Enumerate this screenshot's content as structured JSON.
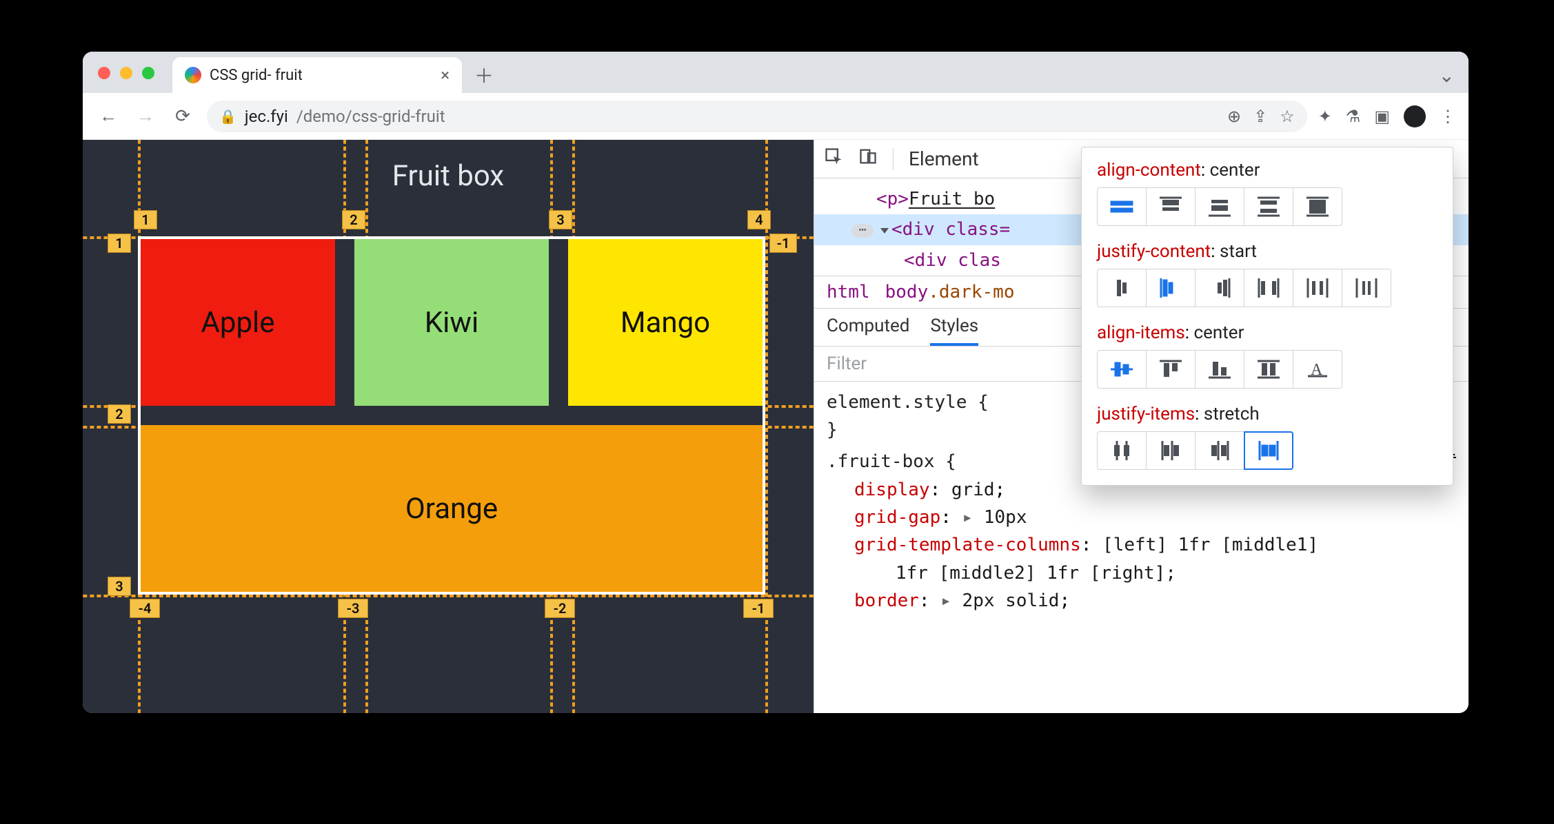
{
  "tab": {
    "title": "CSS grid- fruit"
  },
  "address": {
    "host": "jec.fyi",
    "path": "/demo/css-grid-fruit"
  },
  "page": {
    "heading": "Fruit box",
    "cells": {
      "apple": "Apple",
      "kiwi": "Kiwi",
      "mango": "Mango",
      "orange": "Orange"
    },
    "grid_numbers_top": [
      "1",
      "2",
      "3",
      "4"
    ],
    "grid_numbers_left": [
      "1",
      "2",
      "3"
    ],
    "grid_numbers_right_top": "-1",
    "grid_numbers_bottom": [
      "-4",
      "-3",
      "-2",
      "-1"
    ]
  },
  "devtools": {
    "panel": "Element",
    "dom": {
      "line1_open": "<p>",
      "line1_text": "Fruit bo",
      "line2": "<div class=",
      "line3": "<div clas"
    },
    "crumbs": {
      "a": "html",
      "b": "body",
      "bcls": ".dark-mo"
    },
    "tabs": {
      "computed": "Computed",
      "styles": "Styles"
    },
    "filter_placeholder": "Filter",
    "styles": {
      "inline_open": "element.style {",
      "inline_close": "}",
      "rule_selector": ".fruit-box {",
      "display": {
        "p": "display",
        "v": "grid"
      },
      "gap": {
        "p": "grid-gap",
        "v": "10px"
      },
      "gtc": {
        "p": "grid-template-columns",
        "v": "[left] 1fr [middle1]"
      },
      "gtc2": "1fr [middle2] 1fr [right];",
      "border": {
        "p": "border",
        "v": "2px solid"
      },
      "one": "1"
    }
  },
  "align_pop": {
    "groups": [
      {
        "prop": "align-content",
        "val": "center"
      },
      {
        "prop": "justify-content",
        "val": "start"
      },
      {
        "prop": "align-items",
        "val": "center"
      },
      {
        "prop": "justify-items",
        "val": "stretch"
      }
    ]
  }
}
